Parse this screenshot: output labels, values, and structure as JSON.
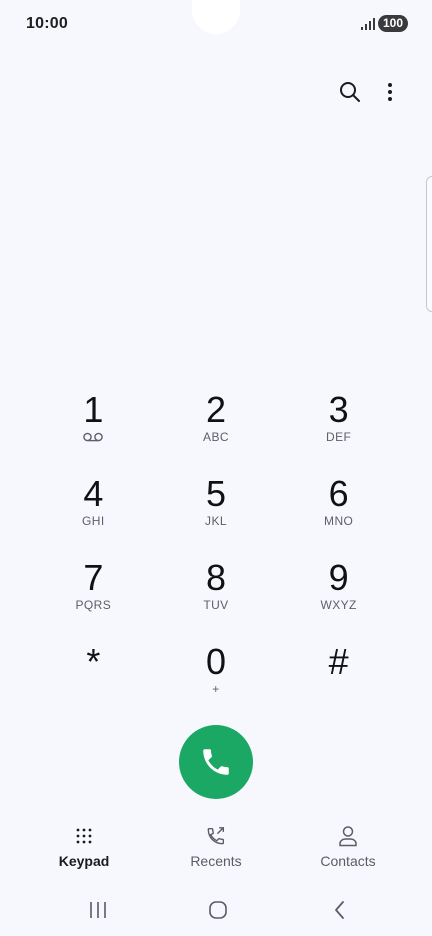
{
  "status_bar": {
    "time": "10:00",
    "battery": "100",
    "signal_icon": "signal-icon"
  },
  "toolbar": {
    "search_icon": "search-icon",
    "more_icon": "more-vertical-icon"
  },
  "keypad": {
    "keys": [
      {
        "digit": "1",
        "letters": "",
        "icon": "voicemail-icon"
      },
      {
        "digit": "2",
        "letters": "ABC"
      },
      {
        "digit": "3",
        "letters": "DEF"
      },
      {
        "digit": "4",
        "letters": "GHI"
      },
      {
        "digit": "5",
        "letters": "JKL"
      },
      {
        "digit": "6",
        "letters": "MNO"
      },
      {
        "digit": "7",
        "letters": "PQRS"
      },
      {
        "digit": "8",
        "letters": "TUV"
      },
      {
        "digit": "9",
        "letters": "WXYZ"
      },
      {
        "digit": "*",
        "letters": ""
      },
      {
        "digit": "0",
        "letters": "+"
      },
      {
        "digit": "#",
        "letters": ""
      }
    ]
  },
  "call_button": {
    "icon": "phone-icon",
    "color": "#1aa864"
  },
  "tabs": [
    {
      "label": "Keypad",
      "icon": "keypad-icon",
      "active": true
    },
    {
      "label": "Recents",
      "icon": "recents-icon",
      "active": false
    },
    {
      "label": "Contacts",
      "icon": "contacts-icon",
      "active": false
    }
  ],
  "nav_bar": {
    "recent_icon": "recent-apps-icon",
    "home_icon": "home-icon",
    "back_icon": "back-icon"
  }
}
